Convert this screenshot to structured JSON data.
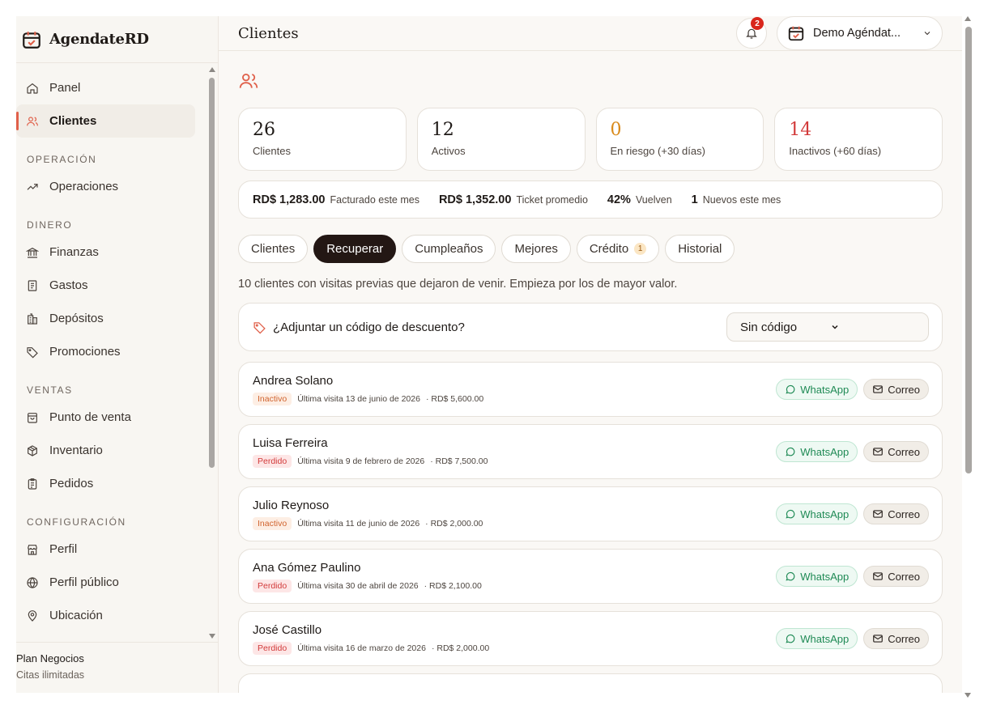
{
  "app": {
    "name": "AgendateRD"
  },
  "colors": {
    "accent": "#e0604a",
    "dark": "#231714",
    "whatsapp": "#1f8a55",
    "danger": "#d9261c"
  },
  "sidebar": {
    "items": [
      {
        "label": "Panel",
        "icon": "home-icon"
      },
      {
        "label": "Clientes",
        "icon": "users-icon",
        "active": true
      }
    ],
    "sections": [
      {
        "title": "OPERACIÓN",
        "items": [
          {
            "label": "Operaciones",
            "icon": "trend-icon"
          }
        ]
      },
      {
        "title": "DINERO",
        "items": [
          {
            "label": "Finanzas",
            "icon": "bank-icon"
          },
          {
            "label": "Gastos",
            "icon": "receipt-icon"
          },
          {
            "label": "Depósitos",
            "icon": "building-icon"
          },
          {
            "label": "Promociones",
            "icon": "tag-icon"
          }
        ]
      },
      {
        "title": "VENTAS",
        "items": [
          {
            "label": "Punto de venta",
            "icon": "shopping-bag-icon"
          },
          {
            "label": "Inventario",
            "icon": "box-icon"
          },
          {
            "label": "Pedidos",
            "icon": "clipboard-icon"
          }
        ]
      },
      {
        "title": "CONFIGURACIÓN",
        "items": [
          {
            "label": "Perfil",
            "icon": "store-icon"
          },
          {
            "label": "Perfil público",
            "icon": "globe-icon"
          },
          {
            "label": "Ubicación",
            "icon": "map-pin-icon"
          }
        ]
      }
    ],
    "plan": {
      "name": "Plan Negocios",
      "subtitle": "Citas ilimitadas"
    }
  },
  "header": {
    "title": "Clientes",
    "notifications": "2",
    "account": "Demo Agéndat..."
  },
  "stats": [
    {
      "value": "26",
      "label": "Clientes",
      "color": "#1f1a17"
    },
    {
      "value": "12",
      "label": "Activos",
      "color": "#1f1a17"
    },
    {
      "value": "0",
      "label": "En riesgo (+30 días)",
      "color": "#d98a1a"
    },
    {
      "value": "14",
      "label": "Inactivos (+60 días)",
      "color": "#d23a3a"
    }
  ],
  "metrics": [
    {
      "value": "RD$ 1,283.00",
      "label": "Facturado este mes"
    },
    {
      "value": "RD$ 1,352.00",
      "label": "Ticket promedio"
    },
    {
      "value": "42%",
      "label": "Vuelven"
    },
    {
      "value": "1",
      "label": "Nuevos este mes"
    }
  ],
  "tabs": [
    {
      "label": "Clientes"
    },
    {
      "label": "Recuperar",
      "active": true
    },
    {
      "label": "Cumpleaños"
    },
    {
      "label": "Mejores"
    },
    {
      "label": "Crédito",
      "count": "1"
    },
    {
      "label": "Historial"
    }
  ],
  "helper": "10 clientes con visitas previas que dejaron de venir. Empieza por los de mayor valor.",
  "discount": {
    "label": "¿Adjuntar un código de descuento?",
    "selected": "Sin código"
  },
  "actions": {
    "whatsapp": "WhatsApp",
    "email": "Correo"
  },
  "clients": [
    {
      "name": "Andrea Solano",
      "status": "Inactivo",
      "last_visit": "Última visita 13 de junio de 2026",
      "amount": "· RD$ 5,600.00"
    },
    {
      "name": "Luisa Ferreira",
      "status": "Perdido",
      "last_visit": "Última visita 9 de febrero de 2026",
      "amount": "· RD$ 7,500.00"
    },
    {
      "name": "Julio Reynoso",
      "status": "Inactivo",
      "last_visit": "Última visita 11 de junio de 2026",
      "amount": "· RD$ 2,000.00"
    },
    {
      "name": "Ana Gómez Paulino",
      "status": "Perdido",
      "last_visit": "Última visita 30 de abril de 2026",
      "amount": "· RD$ 2,100.00"
    },
    {
      "name": "José Castillo",
      "status": "Perdido",
      "last_visit": "Última visita 16 de marzo de 2026",
      "amount": "· RD$ 2,000.00"
    }
  ]
}
